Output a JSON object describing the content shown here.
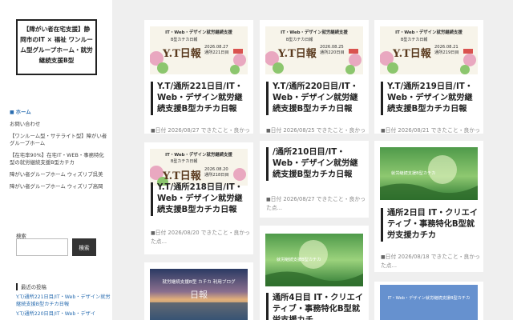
{
  "sidebar": {
    "site_title": "【障がい者在宅支援】静岡市のIT × 福祉 ワンルーム型グループホーム・就労継続支援B型",
    "nav": [
      {
        "label": "ホーム",
        "active": true
      },
      {
        "label": "お問い合わせ",
        "active": false
      },
      {
        "label": "【ワンルーム型・サテライト型】障がい者グループホーム",
        "active": false
      },
      {
        "label": "【在宅率90%】在宅IT・WEB・事務特化型の就労継続支援B型カチカ",
        "active": false
      },
      {
        "label": "障がい者グループホーム ウィズリブ呉美",
        "active": false
      },
      {
        "label": "障がい者グループホーム ウィズリブ高岡",
        "active": false
      }
    ],
    "search_label": "検索",
    "search_placeholder": "",
    "search_button": "検索",
    "recent_heading": "最近の投稿",
    "recent_posts": [
      "Y.T/通所221日目/IT・Web・デザイン就労継続支援B型カチカ日報",
      "Y.T/通所220日目/IT・Web・デザイ"
    ]
  },
  "cards": [
    {
      "title": "Y.T/通所221日目/IT・Web・デザイン就労継続支援B型カチカ日報",
      "meta": "日付 2026/08/27 できたこと・良かった点...",
      "thumb": {
        "type": "banner",
        "top": "IT・Web・デザイン就労継続支援",
        "sub": "B型カチカ日報",
        "big": "Y.T日報",
        "date": "2026.08.27",
        "day": "通所221日目"
      }
    },
    {
      "title": "Y.T/通所220日目/IT・Web・デザイン就労継続支援B型カチカ日報",
      "meta": "日付 2026/08/25 できたこと・良かった点...",
      "thumb": {
        "type": "banner",
        "top": "IT・Web・デザイン就労継続支援",
        "sub": "B型カチカ日報",
        "big": "Y.T日報",
        "date": "2026.08.25",
        "day": "通所220日目"
      }
    },
    {
      "title": "Y.T/通所219日目/IT・Web・デザイン就労継続支援B型カチカ日報",
      "meta": "日付 2026/08/21 できたこと・良かった点...",
      "thumb": {
        "type": "banner",
        "top": "IT・Web・デザイン就労継続支援",
        "sub": "B型カチカ日報",
        "big": "Y.T日報",
        "date": "2026.08.21",
        "day": "通所219日目"
      }
    },
    {
      "title": "Y.T/通所218日目/IT・Web・デザイン就労継続支援B型カチカ日報",
      "meta": "日付 2026/08/20 できたこと・良かった点...",
      "thumb": {
        "type": "banner",
        "top": "IT・Web・デザイン就労継続支援",
        "sub": "B型カチカ日報",
        "big": "Y.T日報",
        "date": "2026.08.20",
        "day": "通所218日目"
      }
    },
    {
      "title": "/通所210日目/IT・Web・デザイン就労継続支援B型カチカ日報",
      "meta": "日付 2026/08/27 できたこと・良かった点...",
      "thumb": null
    },
    {
      "title": "通所2日目 IT・クリエイティブ・事務特化B型就労支援カチカ",
      "meta": "日付 2026/08/18 できたこと・良かった点...",
      "thumb": {
        "type": "green",
        "label": "就労継続支援B型カチカ"
      }
    },
    {
      "title": "",
      "meta": "",
      "thumb": {
        "type": "sea",
        "label": "就労継続支援B型 カチカ 利用ブログ",
        "mark": "日報"
      }
    },
    {
      "title": "通所4日目 IT・クリエイティブ・事務特化B型就労支援カチ",
      "meta": "",
      "thumb": {
        "type": "green",
        "label": "就労継続支援B型カチカ"
      }
    },
    {
      "title": "",
      "meta": "",
      "thumb": {
        "type": "bluebanner",
        "label": "IT・Web・デザイン就労継続支援B型カチカ"
      }
    }
  ],
  "colors": {
    "accent": "#2a6db0",
    "page_bg": "#efefef",
    "card_bg": "#ffffff",
    "banner_bg": "#f7f4ea",
    "banner_big": "#5a3a1e"
  }
}
